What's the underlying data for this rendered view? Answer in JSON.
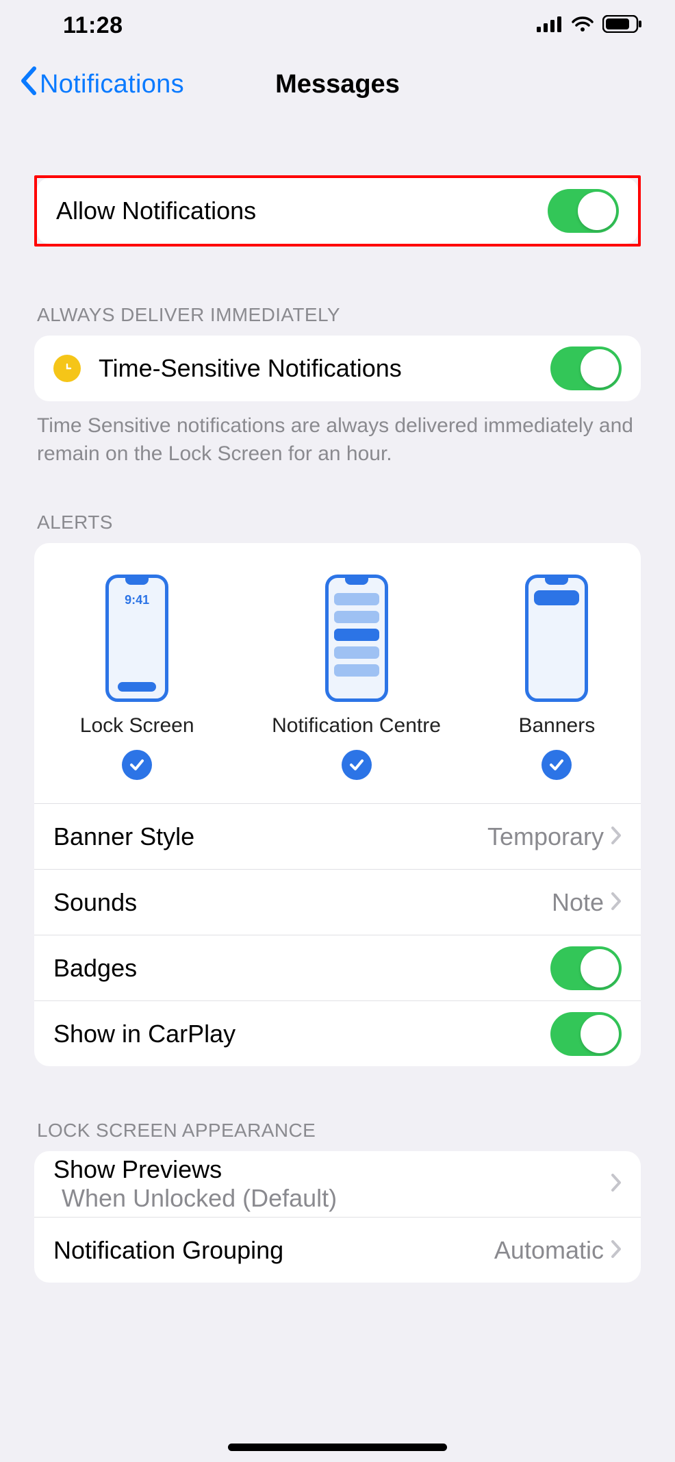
{
  "status": {
    "time": "11:28"
  },
  "nav": {
    "back_label": "Notifications",
    "title": "Messages"
  },
  "allow": {
    "label": "Allow Notifications",
    "on": true
  },
  "deliver": {
    "header": "ALWAYS DELIVER IMMEDIATELY",
    "ts_label": "Time-Sensitive Notifications",
    "ts_on": true,
    "footer": "Time Sensitive notifications are always delivered immediately and remain on the Lock Screen for an hour."
  },
  "alerts": {
    "header": "ALERTS",
    "lockscreen_time": "9:41",
    "options": [
      {
        "label": "Lock Screen",
        "checked": true
      },
      {
        "label": "Notification Centre",
        "checked": true
      },
      {
        "label": "Banners",
        "checked": true
      }
    ],
    "banner_style_label": "Banner Style",
    "banner_style_value": "Temporary",
    "sounds_label": "Sounds",
    "sounds_value": "Note",
    "badges_label": "Badges",
    "badges_on": true,
    "carplay_label": "Show in CarPlay",
    "carplay_on": true
  },
  "lockscreen": {
    "header": "LOCK SCREEN APPEARANCE",
    "previews_label": "Show Previews",
    "previews_value": "When Unlocked (Default)",
    "grouping_label": "Notification Grouping",
    "grouping_value": "Automatic"
  }
}
